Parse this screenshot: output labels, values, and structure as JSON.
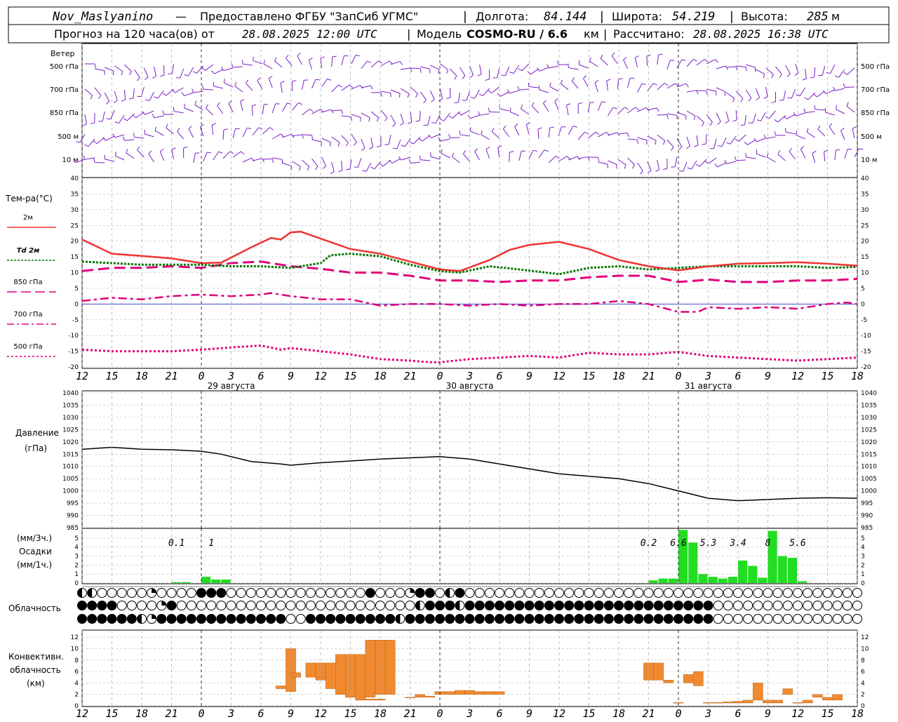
{
  "header": {
    "station": "Nov_Maslyanino",
    "provider": "Предоставлено ФГБУ \"ЗапСиб УГМС\"",
    "lon_label": "Долгота:",
    "lon": "84.144",
    "lat_label": "Широта:",
    "lat": "54.219",
    "alt_label": "Высота:",
    "alt": "285",
    "alt_unit": "м",
    "forecast_prefix": "Прогноз на 120 часа(ов) от",
    "forecast_from": "28.08.2025 12:00 UTC",
    "model_label": "Модель",
    "model": "COSMO-RU / 6.6",
    "model_unit": "км",
    "calc_label": "Рассчитано:",
    "calc": "28.08.2025 16:38 UTC"
  },
  "wind_panel": {
    "title": "Ветер",
    "levels": [
      "500 гПа",
      "700 гПа",
      "850 гПа",
      "500 м",
      "10 м"
    ]
  },
  "time_axis": {
    "ticks": [
      "12",
      "15",
      "18",
      "21",
      "0",
      "3",
      "6",
      "9",
      "12",
      "15",
      "18",
      "21",
      "0",
      "3",
      "6",
      "9",
      "12",
      "15",
      "18",
      "21",
      "0",
      "3",
      "6",
      "9",
      "12",
      "15",
      "18"
    ],
    "day_labels": [
      "29 августа",
      "30 августа",
      "31 августа"
    ],
    "day_label_hours": [
      15,
      39,
      63
    ],
    "midnight_hours": [
      12,
      36,
      60
    ]
  },
  "temperature_panel": {
    "title": "Тем-ра(°С)",
    "legend": [
      {
        "label": "2м",
        "color": "#ff3333",
        "dash": ""
      },
      {
        "label": "Td  2м",
        "color": "#007700",
        "dash": "3,2"
      },
      {
        "label": "850 гПа",
        "color": "#e0007a",
        "dash": "14,6"
      },
      {
        "label": "700 гПа",
        "color": "#e0007a",
        "dash": "10,4,3,4"
      },
      {
        "label": "500 гПа",
        "color": "#e0007a",
        "dash": "3,3"
      }
    ],
    "ylim": [
      -20,
      40
    ],
    "yticks": [
      "40",
      "35",
      "30",
      "25",
      "20",
      "15",
      "10",
      "5",
      "0",
      "-5",
      "-10",
      "-15",
      "-20"
    ]
  },
  "pressure_panel": {
    "title": "Давление",
    "unit": "(гПа)",
    "ylim": [
      985,
      1040
    ],
    "yticks": [
      "1040",
      "1035",
      "1030",
      "1025",
      "1020",
      "1015",
      "1010",
      "1005",
      "1000",
      "995",
      "990",
      "985"
    ]
  },
  "precip_panel": {
    "unit3h": "(мм/3ч.)",
    "title": "Осадки",
    "unit1h": "(мм/1ч.)",
    "ylim": [
      0,
      6
    ],
    "yticks": [
      "5",
      "4",
      "3",
      "2",
      "1",
      "0"
    ],
    "totals": [
      {
        "hour": 9.5,
        "label": "0.1"
      },
      {
        "hour": 13,
        "label": "1"
      },
      {
        "hour": 57,
        "label": "0.2"
      },
      {
        "hour": 60,
        "label": "6.6"
      },
      {
        "hour": 63,
        "label": "5.3"
      },
      {
        "hour": 66,
        "label": "3.4"
      },
      {
        "hour": 69,
        "label": "8"
      },
      {
        "hour": 72,
        "label": "5.6"
      }
    ]
  },
  "cloud_panel": {
    "title": "Облачность"
  },
  "conv_panel": {
    "title1": "Конвективн.",
    "title2": "облачность",
    "unit": "(км)",
    "ylim": [
      0,
      13
    ],
    "yticks": [
      "12",
      "10",
      "8",
      "6",
      "4",
      "2",
      "0"
    ]
  },
  "chart_data": {
    "type": "line",
    "x_unit": "hours from 28.08.2025 12:00 UTC",
    "temperature": {
      "t2m": [
        [
          0,
          20.5
        ],
        [
          3,
          16
        ],
        [
          6,
          15.3
        ],
        [
          9,
          14.5
        ],
        [
          12,
          13
        ],
        [
          14,
          13.2
        ],
        [
          17,
          18
        ],
        [
          19,
          21
        ],
        [
          20,
          20.5
        ],
        [
          21,
          22.8
        ],
        [
          22,
          23
        ],
        [
          24,
          20.8
        ],
        [
          27,
          17.5
        ],
        [
          30,
          16
        ],
        [
          33,
          13.5
        ],
        [
          36,
          11
        ],
        [
          38,
          10.5
        ],
        [
          41,
          14
        ],
        [
          43,
          17.2
        ],
        [
          45,
          18.8
        ],
        [
          48,
          19.8
        ],
        [
          51,
          17.5
        ],
        [
          54,
          14
        ],
        [
          57,
          12
        ],
        [
          60,
          10.7
        ],
        [
          63,
          12
        ],
        [
          66,
          12.8
        ],
        [
          69,
          13
        ],
        [
          72,
          13.3
        ],
        [
          75,
          12.8
        ],
        [
          78,
          12.2
        ]
      ],
      "td2m": [
        [
          0,
          13.5
        ],
        [
          3,
          13
        ],
        [
          6,
          12.5
        ],
        [
          9,
          12.5
        ],
        [
          12,
          12.5
        ],
        [
          15,
          12
        ],
        [
          18,
          12
        ],
        [
          21,
          11.5
        ],
        [
          24,
          13
        ],
        [
          25,
          15.5
        ],
        [
          27,
          16
        ],
        [
          30,
          15.2
        ],
        [
          33,
          12.5
        ],
        [
          36,
          10.5
        ],
        [
          38,
          10
        ],
        [
          41,
          12
        ],
        [
          44,
          11
        ],
        [
          48,
          9.5
        ],
        [
          51,
          11.5
        ],
        [
          54,
          12
        ],
        [
          57,
          11
        ],
        [
          60,
          11.5
        ],
        [
          63,
          12
        ],
        [
          66,
          12
        ],
        [
          69,
          12
        ],
        [
          72,
          12
        ],
        [
          75,
          11.5
        ],
        [
          78,
          11.8
        ]
      ],
      "t850": [
        [
          0,
          10.5
        ],
        [
          3,
          11.5
        ],
        [
          6,
          11.5
        ],
        [
          9,
          12
        ],
        [
          12,
          11.5
        ],
        [
          15,
          13
        ],
        [
          18,
          13.5
        ],
        [
          21,
          12
        ],
        [
          24,
          11.2
        ],
        [
          27,
          10
        ],
        [
          30,
          10
        ],
        [
          33,
          9
        ],
        [
          36,
          7.5
        ],
        [
          39,
          7.5
        ],
        [
          42,
          7
        ],
        [
          45,
          7.5
        ],
        [
          48,
          7.5
        ],
        [
          51,
          8.5
        ],
        [
          54,
          9
        ],
        [
          57,
          9
        ],
        [
          60,
          7
        ],
        [
          62,
          7.5
        ],
        [
          63,
          7.8
        ],
        [
          66,
          7
        ],
        [
          69,
          7
        ],
        [
          72,
          7.5
        ],
        [
          75,
          7.5
        ],
        [
          78,
          8
        ]
      ],
      "t700": [
        [
          0,
          1
        ],
        [
          3,
          2
        ],
        [
          6,
          1.5
        ],
        [
          9,
          2.5
        ],
        [
          12,
          3
        ],
        [
          15,
          2.5
        ],
        [
          18,
          3
        ],
        [
          19,
          3.5
        ],
        [
          21,
          2.5
        ],
        [
          24,
          1.5
        ],
        [
          27,
          1.5
        ],
        [
          30,
          -0.5
        ],
        [
          33,
          0
        ],
        [
          36,
          0
        ],
        [
          39,
          -0.5
        ],
        [
          42,
          0
        ],
        [
          45,
          -0.5
        ],
        [
          48,
          0
        ],
        [
          51,
          0
        ],
        [
          54,
          1
        ],
        [
          57,
          0
        ],
        [
          60,
          -2.5
        ],
        [
          62,
          -2.5
        ],
        [
          63,
          -1
        ],
        [
          66,
          -1.5
        ],
        [
          69,
          -1
        ],
        [
          72,
          -1.5
        ],
        [
          75,
          0
        ],
        [
          77,
          0.5
        ],
        [
          78,
          0
        ]
      ],
      "t500": [
        [
          0,
          -14.5
        ],
        [
          3,
          -15
        ],
        [
          6,
          -15
        ],
        [
          9,
          -15
        ],
        [
          12,
          -14.5
        ],
        [
          15,
          -13.8
        ],
        [
          18,
          -13.2
        ],
        [
          20,
          -14.5
        ],
        [
          21,
          -14
        ],
        [
          24,
          -15
        ],
        [
          27,
          -16
        ],
        [
          30,
          -17.5
        ],
        [
          33,
          -18
        ],
        [
          35,
          -18.5
        ],
        [
          36,
          -18.5
        ],
        [
          39,
          -17.5
        ],
        [
          42,
          -17
        ],
        [
          45,
          -16.5
        ],
        [
          48,
          -17
        ],
        [
          51,
          -15.5
        ],
        [
          54,
          -16
        ],
        [
          57,
          -16
        ],
        [
          60,
          -15.2
        ],
        [
          63,
          -16.5
        ],
        [
          66,
          -17
        ],
        [
          69,
          -17.5
        ],
        [
          72,
          -18
        ],
        [
          75,
          -17.5
        ],
        [
          78,
          -17
        ]
      ]
    },
    "pressure": [
      [
        0,
        1017
      ],
      [
        3,
        1017.8
      ],
      [
        6,
        1017
      ],
      [
        9,
        1016.8
      ],
      [
        12,
        1016.2
      ],
      [
        14,
        1015
      ],
      [
        17,
        1012
      ],
      [
        20,
        1011
      ],
      [
        21,
        1010.5
      ],
      [
        24,
        1011.5
      ],
      [
        27,
        1012.2
      ],
      [
        30,
        1013
      ],
      [
        33,
        1013.5
      ],
      [
        36,
        1014
      ],
      [
        39,
        1013
      ],
      [
        42,
        1011
      ],
      [
        45,
        1009
      ],
      [
        48,
        1007
      ],
      [
        51,
        1006
      ],
      [
        54,
        1005
      ],
      [
        57,
        1003
      ],
      [
        60,
        1000
      ],
      [
        62,
        998
      ],
      [
        63,
        997
      ],
      [
        66,
        996
      ],
      [
        69,
        996.5
      ],
      [
        72,
        997
      ],
      [
        75,
        997.2
      ],
      [
        78,
        997
      ]
    ],
    "precip_1h": [
      [
        9.5,
        0.1
      ],
      [
        10.5,
        0.1
      ],
      [
        12.5,
        0.7
      ],
      [
        13.5,
        0.4
      ],
      [
        14.5,
        0.4
      ],
      [
        57.5,
        0.3
      ],
      [
        58.5,
        0.5
      ],
      [
        59.5,
        0.5
      ],
      [
        60.5,
        5.9
      ],
      [
        61.5,
        4.5
      ],
      [
        62.5,
        1
      ],
      [
        63.5,
        0.7
      ],
      [
        64.5,
        0.5
      ],
      [
        65.5,
        0.7
      ],
      [
        66.5,
        2.5
      ],
      [
        67.5,
        1.9
      ],
      [
        68.5,
        0.6
      ],
      [
        69.5,
        5.8
      ],
      [
        70.5,
        3
      ],
      [
        71.5,
        2.8
      ],
      [
        72.5,
        0.2
      ]
    ],
    "clouds": {
      "rows": [
        "LLWWWWWRWWWWHHHWWWWWWWWWWWWWWHWWWRHHWLHWWWWWWWWWWWWWWWWWWWWWWWWWWWWWWWWWWWWWWWW",
        "HHHHWWWWRHWWWWWWWWWWWWWWWWWWWWWWWWLHHHLHHHHHHHHHHHHHHHHHHHHHHHHHWWWWWWWWWWWWWWWW",
        "HHHHHHLRHHHHHHHHHHHHHWWHHHHHHHHHLHHHHHHHHHHHHHHHHHHHHHHHHHHHHHHHWWWWWWWWWWWWWWWWWWW"
      ]
    },
    "convective_cloud": [
      [
        20,
        3,
        3.5
      ],
      [
        21,
        2.5,
        10
      ],
      [
        24,
        4.5,
        5.2
      ],
      [
        28,
        1,
        1.2
      ],
      [
        29,
        1,
        1.2
      ],
      [
        30,
        1,
        1.2
      ],
      [
        21.5,
        5,
        5.8
      ],
      [
        23,
        5,
        7.5
      ],
      [
        24,
        5,
        7.5
      ],
      [
        25,
        3,
        7.5
      ],
      [
        26,
        2,
        9
      ],
      [
        27,
        1.5,
        9
      ],
      [
        28,
        1,
        9
      ],
      [
        29,
        1.5,
        11.5
      ],
      [
        30,
        2,
        11.5
      ],
      [
        31,
        2,
        11.5
      ],
      [
        33,
        1.5,
        1.5
      ],
      [
        34,
        1.5,
        2
      ],
      [
        35,
        1.5,
        1.7
      ],
      [
        36,
        2,
        2.5
      ],
      [
        37,
        2,
        2.5
      ],
      [
        38,
        2,
        2.7
      ],
      [
        39,
        2,
        2.7
      ],
      [
        40,
        2,
        2.5
      ],
      [
        41,
        2,
        2.5
      ],
      [
        42,
        2,
        2.5
      ],
      [
        57,
        4.5,
        7.5
      ],
      [
        58,
        4.5,
        7.5
      ],
      [
        59,
        4,
        4.5
      ],
      [
        60,
        0.5,
        0.6
      ],
      [
        61,
        4,
        5.5
      ],
      [
        62,
        3.5,
        6
      ],
      [
        63,
        0.5,
        0.6
      ],
      [
        64,
        0.5,
        0.6
      ],
      [
        65,
        0.5,
        0.7
      ],
      [
        66,
        0.5,
        0.8
      ],
      [
        67,
        0.5,
        1
      ],
      [
        68,
        1,
        4
      ],
      [
        69,
        0.5,
        1
      ],
      [
        70,
        0.5,
        1
      ],
      [
        71,
        2,
        3
      ],
      [
        72,
        0.5,
        0.6
      ],
      [
        73,
        0.5,
        1
      ],
      [
        74,
        1.5,
        2
      ],
      [
        75,
        1,
        1.5
      ],
      [
        76,
        1,
        2
      ]
    ]
  }
}
